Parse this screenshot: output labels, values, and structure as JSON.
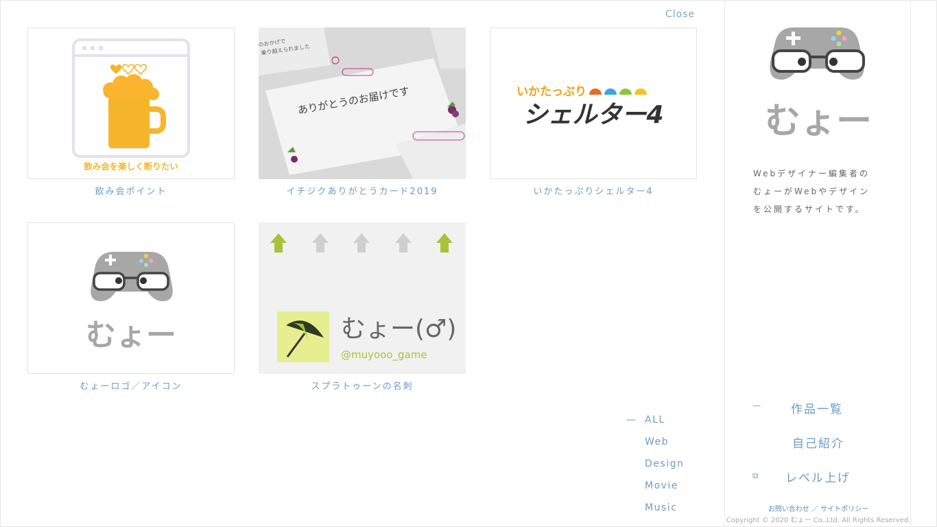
{
  "close_label": "Close",
  "works": [
    {
      "caption": "飲み会ポイント",
      "thumb_text": "飲み会を楽しく断りたい"
    },
    {
      "caption": "イチジクありがとうカード2019",
      "thumb_text": "ありがとうのお届けです",
      "thumb_sub1": "のおかげで",
      "thumb_sub2": "乗り越えられました"
    },
    {
      "caption": "いかたっぷりシェルター4",
      "thumb_text": "いかたっぷり",
      "thumb_text2": "シェルター4"
    },
    {
      "caption": "むょーロゴ／アイコン",
      "thumb_text": "むょー"
    },
    {
      "caption": "スプラトゥーンの名刺",
      "thumb_text": "むょー(♂)",
      "thumb_sub1": "@muyooo_game"
    }
  ],
  "filters": [
    {
      "label": "ALL",
      "active": true
    },
    {
      "label": "Web",
      "active": false
    },
    {
      "label": "Design",
      "active": false
    },
    {
      "label": "Movie",
      "active": false
    },
    {
      "label": "Music",
      "active": false
    }
  ],
  "sidebar": {
    "logo_text": "むょー",
    "description": [
      "Webデザイナー編集者の",
      "むょーがWebやデザイン",
      "を公開するサイトです。"
    ],
    "nav": [
      {
        "label": "作品一覧",
        "mark": "—"
      },
      {
        "label": "自己紹介",
        "mark": ""
      },
      {
        "label": "レベル上げ",
        "mark": "⧉"
      }
    ],
    "footer_contact": "お問い合わせ",
    "footer_sep": "／",
    "footer_policy": "サイトポリシー",
    "copyright": "Copyright © 2020 むょー Co.,Ltd. All Rights Reserved."
  },
  "colors": {
    "accent": "#6a9dc3",
    "logo_gray": "#a7a7a7",
    "beer": "#f7b52b"
  }
}
